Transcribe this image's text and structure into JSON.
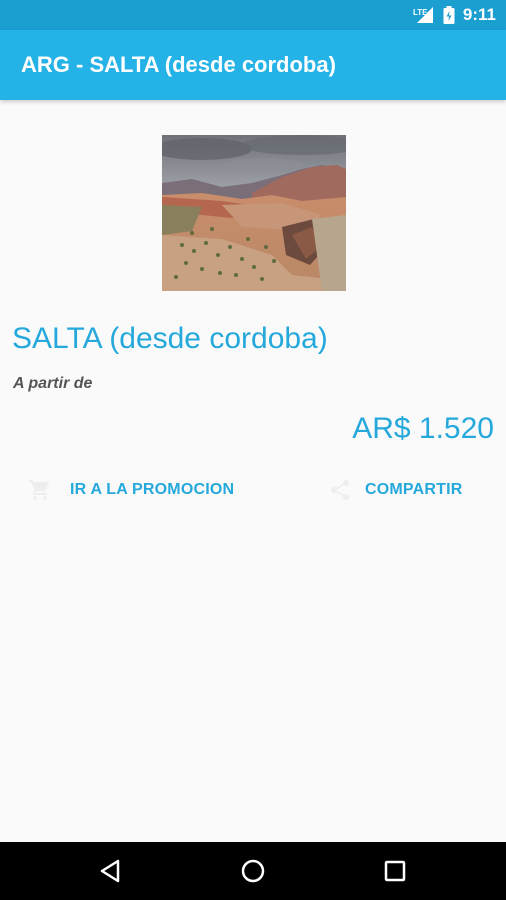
{
  "status_bar": {
    "network_label": "LTE",
    "time": "9:11",
    "icons": [
      "lte-signal-icon",
      "battery-icon"
    ]
  },
  "app_bar": {
    "title": "ARG - SALTA (desde cordoba)"
  },
  "promo": {
    "image": "salta-landscape-image",
    "title": "SALTA (desde cordoba)",
    "price_label": "A partir de",
    "price": "AR$ 1.520"
  },
  "actions": {
    "go_label": "IR A LA PROMOCION",
    "go_icon": "cart-icon",
    "share_label": "COMPARTIR",
    "share_icon": "share-icon"
  },
  "nav_bar": {
    "icons": [
      "back-icon",
      "home-icon",
      "recents-icon"
    ]
  },
  "colors": {
    "status_bar": "#1b9ed0",
    "app_bar": "#25b3e7",
    "accent_text": "#25a8db",
    "background": "#fafafa",
    "nav_bar": "#000000"
  }
}
